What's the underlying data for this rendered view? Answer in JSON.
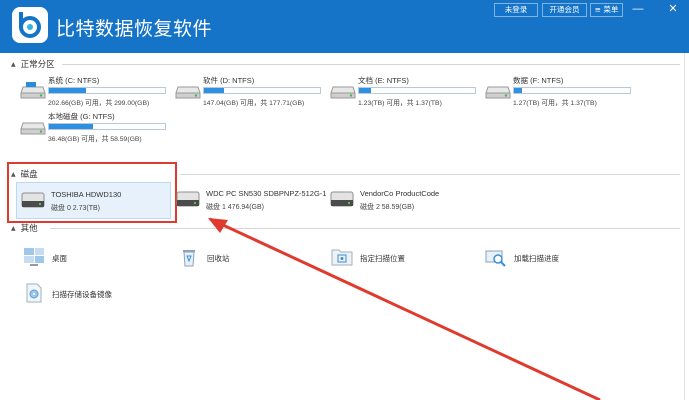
{
  "window": {
    "title": "比特数据恢复软件",
    "buttons": {
      "login": "未登录",
      "vip": "开通会员",
      "menu": "≡ 菜单",
      "minimize": "—",
      "close": "✕"
    }
  },
  "sections": {
    "partitions": "正常分区",
    "disks": "磁盘",
    "other": "其他"
  },
  "partitions": [
    {
      "name": "系统 (C: NTFS)",
      "info": "202.66(GB) 可用，共 299.00(GB)",
      "used_fraction": 0.32
    },
    {
      "name": "软件 (D: NTFS)",
      "info": "147.04(GB) 可用，共 177.71(GB)",
      "used_fraction": 0.17
    },
    {
      "name": "文档 (E: NTFS)",
      "info": "1.23(TB) 可用，共 1.37(TB)",
      "used_fraction": 0.1
    },
    {
      "name": "数据 (F: NTFS)",
      "info": "1.27(TB) 可用，共 1.37(TB)",
      "used_fraction": 0.07
    },
    {
      "name": "本地磁盘 (G: NTFS)",
      "info": "36.48(GB) 可用，共 58.59(GB)",
      "used_fraction": 0.38
    }
  ],
  "disks": [
    {
      "name": "TOSHIBA HDWD130",
      "info": "磁盘 0    2.73(TB)"
    },
    {
      "name": "WDC PC SN530 SDBPNPZ-512G-10",
      "info": "磁盘 1    476.94(GB)"
    },
    {
      "name": "VendorCo ProductCode",
      "info": "磁盘 2    58.59(GB)"
    }
  ],
  "other": [
    {
      "label": "桌面",
      "icon": "desktop-icon"
    },
    {
      "label": "回收站",
      "icon": "recycle-bin-icon"
    },
    {
      "label": "指定扫描位置",
      "icon": "folder-scan-icon"
    },
    {
      "label": "加载扫描进度",
      "icon": "load-progress-icon"
    },
    {
      "label": "扫描存储设备镜像",
      "icon": "disk-image-icon"
    }
  ],
  "colors": {
    "titlebar": "#1574c8",
    "accent": "#2d90e0",
    "highlight": "#e03a2e"
  }
}
